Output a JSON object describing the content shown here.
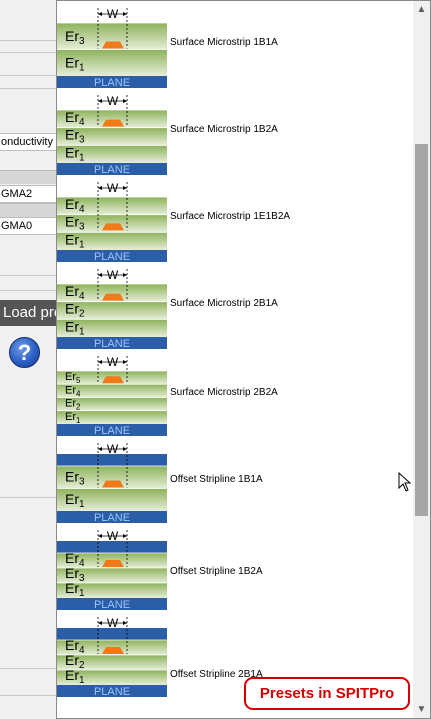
{
  "background_window": {
    "conductivity_label": "onductivity",
    "field_1": "GMA2",
    "field_2": "GMA0",
    "load_button_label": "Load pre",
    "help_icon": "question-circle-icon"
  },
  "preset_list": {
    "items": [
      {
        "label": "Surface Microstrip 1B1A",
        "kind": "microstrip",
        "layers": [
          {
            "n": "3"
          },
          {
            "n": "1"
          }
        ]
      },
      {
        "label": "Surface Microstrip 1B2A",
        "kind": "microstrip",
        "layers": [
          {
            "n": "4"
          },
          {
            "n": "3"
          },
          {
            "n": "1"
          }
        ]
      },
      {
        "label": "Surface Microstrip 1E1B2A",
        "kind": "embedded",
        "layers": [
          {
            "n": "4"
          },
          {
            "n": "3"
          },
          {
            "n": "1"
          }
        ]
      },
      {
        "label": "Surface Microstrip 2B1A",
        "kind": "microstrip",
        "layers": [
          {
            "n": "4"
          },
          {
            "n": "2"
          },
          {
            "n": "1"
          }
        ]
      },
      {
        "label": "Surface Microstrip 2B2A",
        "kind": "microstrip",
        "layers": [
          {
            "n": "5"
          },
          {
            "n": "4"
          },
          {
            "n": "2"
          },
          {
            "n": "1"
          }
        ]
      },
      {
        "label": "Offset Stripline 1B1A",
        "kind": "stripline",
        "layers": [
          {
            "n": "3"
          },
          {
            "n": "1"
          }
        ]
      },
      {
        "label": "Offset Stripline 1B2A",
        "kind": "stripline",
        "layers": [
          {
            "n": "4"
          },
          {
            "n": "3"
          },
          {
            "n": "1"
          }
        ]
      },
      {
        "label": "Offset Stripline 2B1A",
        "kind": "stripline",
        "layers": [
          {
            "n": "4"
          },
          {
            "n": "2"
          },
          {
            "n": "1"
          }
        ]
      }
    ],
    "plane_label": "PLANE",
    "width_label": "W",
    "er_prefix": "Er"
  },
  "callout": {
    "text": "Presets in SPITPro"
  },
  "colors": {
    "green": "#8db25a",
    "green_light": "#e6eed8",
    "plane": "#2b5ea7",
    "trace": "#f07a1a",
    "accent": "#d40000"
  }
}
